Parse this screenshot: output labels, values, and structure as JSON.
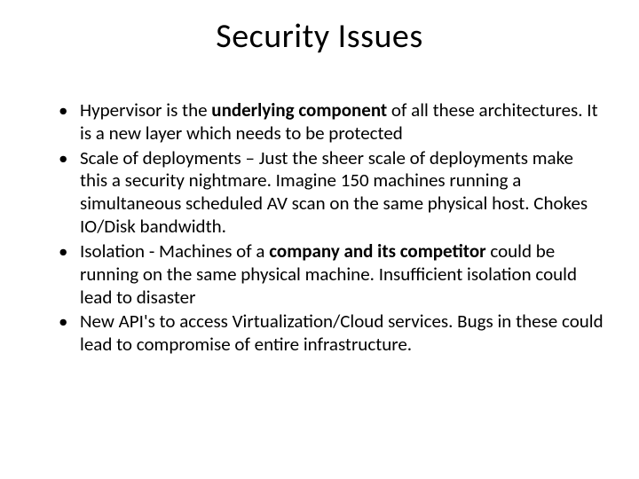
{
  "title": "Security Issues",
  "bullets": [
    {
      "pre": "Hypervisor is the ",
      "bold": "underlying component",
      "post": " of all these architectures. It is a new layer which needs to be protected"
    },
    {
      "pre": "Scale of deployments – Just the sheer scale of deployments make this a security nightmare. Imagine 150 machines running a simultaneous scheduled AV scan on the same physical host. Chokes IO/Disk bandwidth.",
      "bold": "",
      "post": ""
    },
    {
      "pre": "Isolation - Machines of a ",
      "bold": "company and its competitor",
      "post": " could be running on the same physical machine. Insufficient isolation could lead to disaster"
    },
    {
      "pre": "New API's to access Virtualization/Cloud services. Bugs in these could lead to compromise of entire infrastructure.",
      "bold": "",
      "post": ""
    }
  ]
}
